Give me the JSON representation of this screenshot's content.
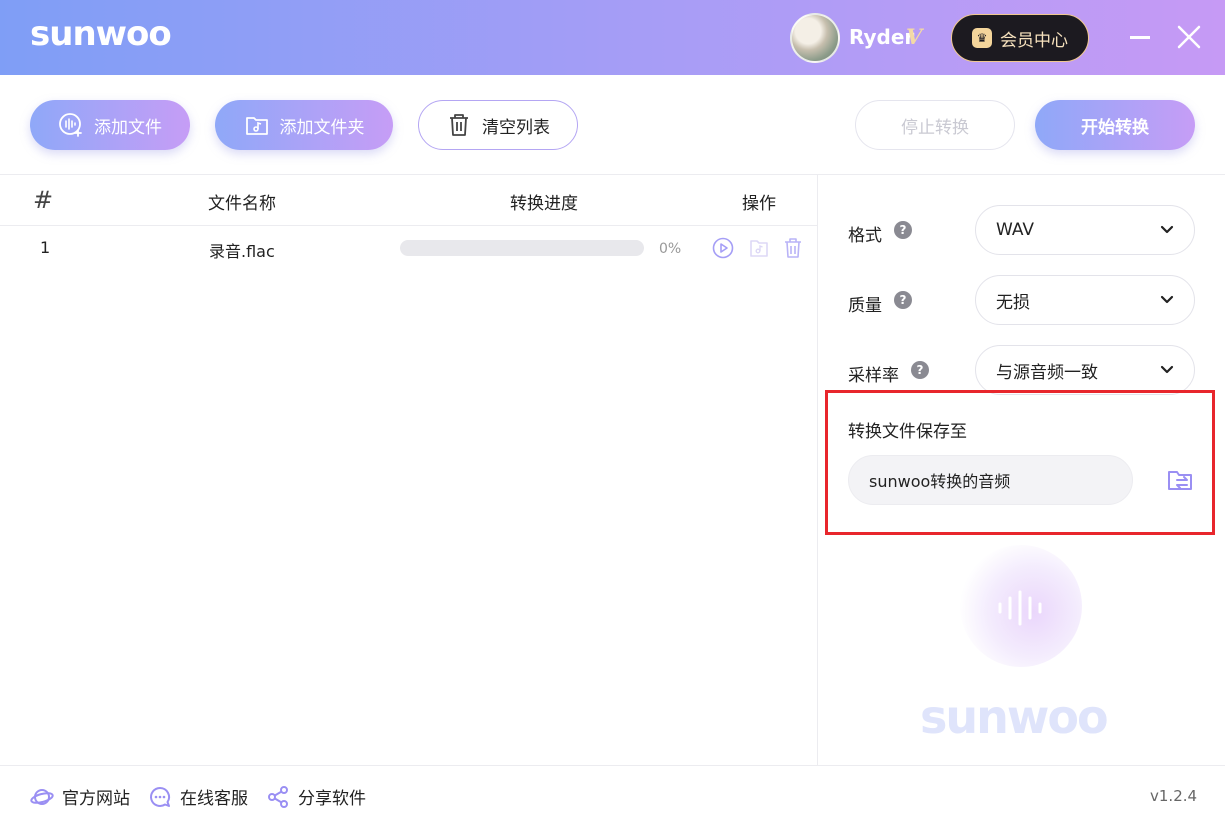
{
  "app": {
    "logo": "sunwoo"
  },
  "user": {
    "name": "Ryder",
    "vip_badge": "V",
    "member_center_label": "会员中心"
  },
  "toolbar": {
    "add_file": "添加文件",
    "add_folder": "添加文件夹",
    "clear_list": "清空列表",
    "stop_convert": "停止转换",
    "start_convert": "开始转换"
  },
  "table": {
    "headers": {
      "index": "#",
      "name": "文件名称",
      "progress": "转换进度",
      "actions": "操作"
    },
    "rows": [
      {
        "index": "1",
        "name": "录音.flac",
        "progress": 0,
        "progress_label": "0%"
      }
    ]
  },
  "settings": {
    "format": {
      "label": "格式",
      "value": "WAV"
    },
    "quality": {
      "label": "质量",
      "value": "无损"
    },
    "sample_rate": {
      "label": "采样率",
      "value": "与源音频一致"
    },
    "save_to": {
      "label": "转换文件保存至",
      "value": "sunwoo转换的音频"
    }
  },
  "footer": {
    "website": "官方网站",
    "support": "在线客服",
    "share": "分享软件",
    "version": "v1.2.4"
  },
  "colors": {
    "accent": "#a59ef6",
    "highlight": "#e8262c"
  }
}
